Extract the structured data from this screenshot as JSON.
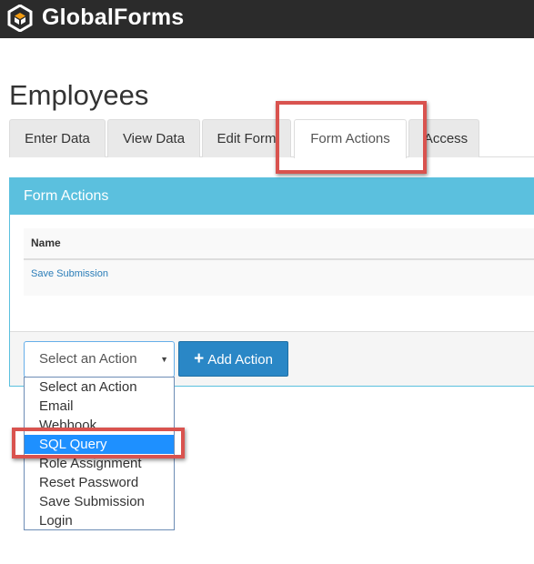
{
  "app": {
    "brand": "GlobalForms"
  },
  "page": {
    "title": "Employees"
  },
  "tabs": [
    {
      "label": "Enter Data"
    },
    {
      "label": "View Data"
    },
    {
      "label": "Edit Form"
    },
    {
      "label": "Form Actions",
      "active": true
    },
    {
      "label": "Access"
    }
  ],
  "panel": {
    "heading": "Form Actions",
    "table": {
      "columns": [
        "Name"
      ],
      "rows": [
        {
          "name": "Save Submission"
        }
      ]
    }
  },
  "action_select": {
    "selected": "Select an Action",
    "options": [
      "Select an Action",
      "Email",
      "Webhook",
      "SQL Query",
      "Role Assignment",
      "Reset Password",
      "Save Submission",
      "Login"
    ],
    "highlighted": "SQL Query"
  },
  "add_action_button": {
    "icon": "plus-icon",
    "label": "Add Action"
  },
  "colors": {
    "topbar": "#2b2b2b",
    "panel_header": "#5bc0de",
    "primary_button": "#2a87c6",
    "annotation": "#d9534f",
    "highlight": "#1e90ff"
  }
}
